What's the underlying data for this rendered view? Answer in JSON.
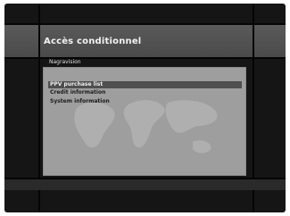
{
  "header": {
    "title": "Accès conditionnel",
    "subtitle": "Nagravision"
  },
  "menu": {
    "items": [
      {
        "label": "PPV purchase list",
        "selected": true
      },
      {
        "label": "Credit information",
        "selected": false
      },
      {
        "label": "System information",
        "selected": false
      }
    ]
  },
  "colors": {
    "background": "#151515",
    "title_band": "#555555",
    "panel": "#9e9e9e",
    "selection": "#4f4f4f"
  }
}
